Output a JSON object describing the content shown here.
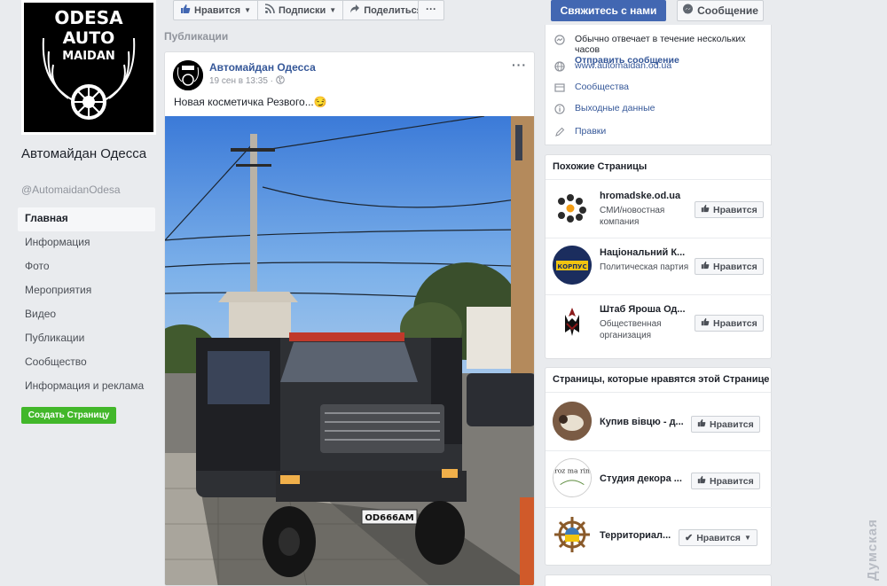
{
  "page": {
    "name": "Автомайдан Одесса",
    "handle": "@AutomaidanOdesa",
    "logo_text": [
      "ODESA",
      "AUTO",
      "MAIDAN"
    ]
  },
  "nav": {
    "items": [
      {
        "label": "Главная",
        "active": true
      },
      {
        "label": "Информация"
      },
      {
        "label": "Фото"
      },
      {
        "label": "Мероприятия"
      },
      {
        "label": "Видео"
      },
      {
        "label": "Публикации"
      },
      {
        "label": "Сообщество"
      },
      {
        "label": "Информация и реклама"
      }
    ],
    "create_page": "Создать Страницу"
  },
  "actions": {
    "like": "Нравится",
    "follow": "Подписки",
    "share": "Поделиться",
    "more": "···",
    "contact": "Свяжитесь с нами",
    "message": "Сообщение"
  },
  "section_label": "Публикации",
  "post": {
    "author": "Автомайдан Одесса",
    "time": "19 сен в 13:35 ·",
    "text": "Новая косметичка Резвого...😏",
    "plate": "OD666AM"
  },
  "about": {
    "response": "Обычно отвечает в течение нескольких часов",
    "send_message": "Отправить сообщение",
    "website": "www.automaidan.od.ua",
    "communities": "Сообщества",
    "imprint": "Выходные данные",
    "edits": "Правки"
  },
  "similar": {
    "title": "Похожие Страницы",
    "items": [
      {
        "name": "hromadske.od.ua",
        "sub": "СМИ/новостная компания",
        "btn": "Нравится"
      },
      {
        "name": "Національний К...",
        "sub": "Политическая партия",
        "btn": "Нравится",
        "logo": "КОРПУС"
      },
      {
        "name": "Штаб Яроша Од...",
        "sub": "Общественная организация",
        "btn": "Нравится"
      }
    ]
  },
  "liked": {
    "title": "Страницы, которые нравятся этой Странице",
    "items": [
      {
        "name": "Купив вівцю - д...",
        "btn": "Нравится"
      },
      {
        "name": "Студия декора ...",
        "btn": "Нравится",
        "logo": "roz ma rin"
      },
      {
        "name": "Территориал...",
        "btn": "Нравится"
      }
    ]
  },
  "watermark": "Думская"
}
